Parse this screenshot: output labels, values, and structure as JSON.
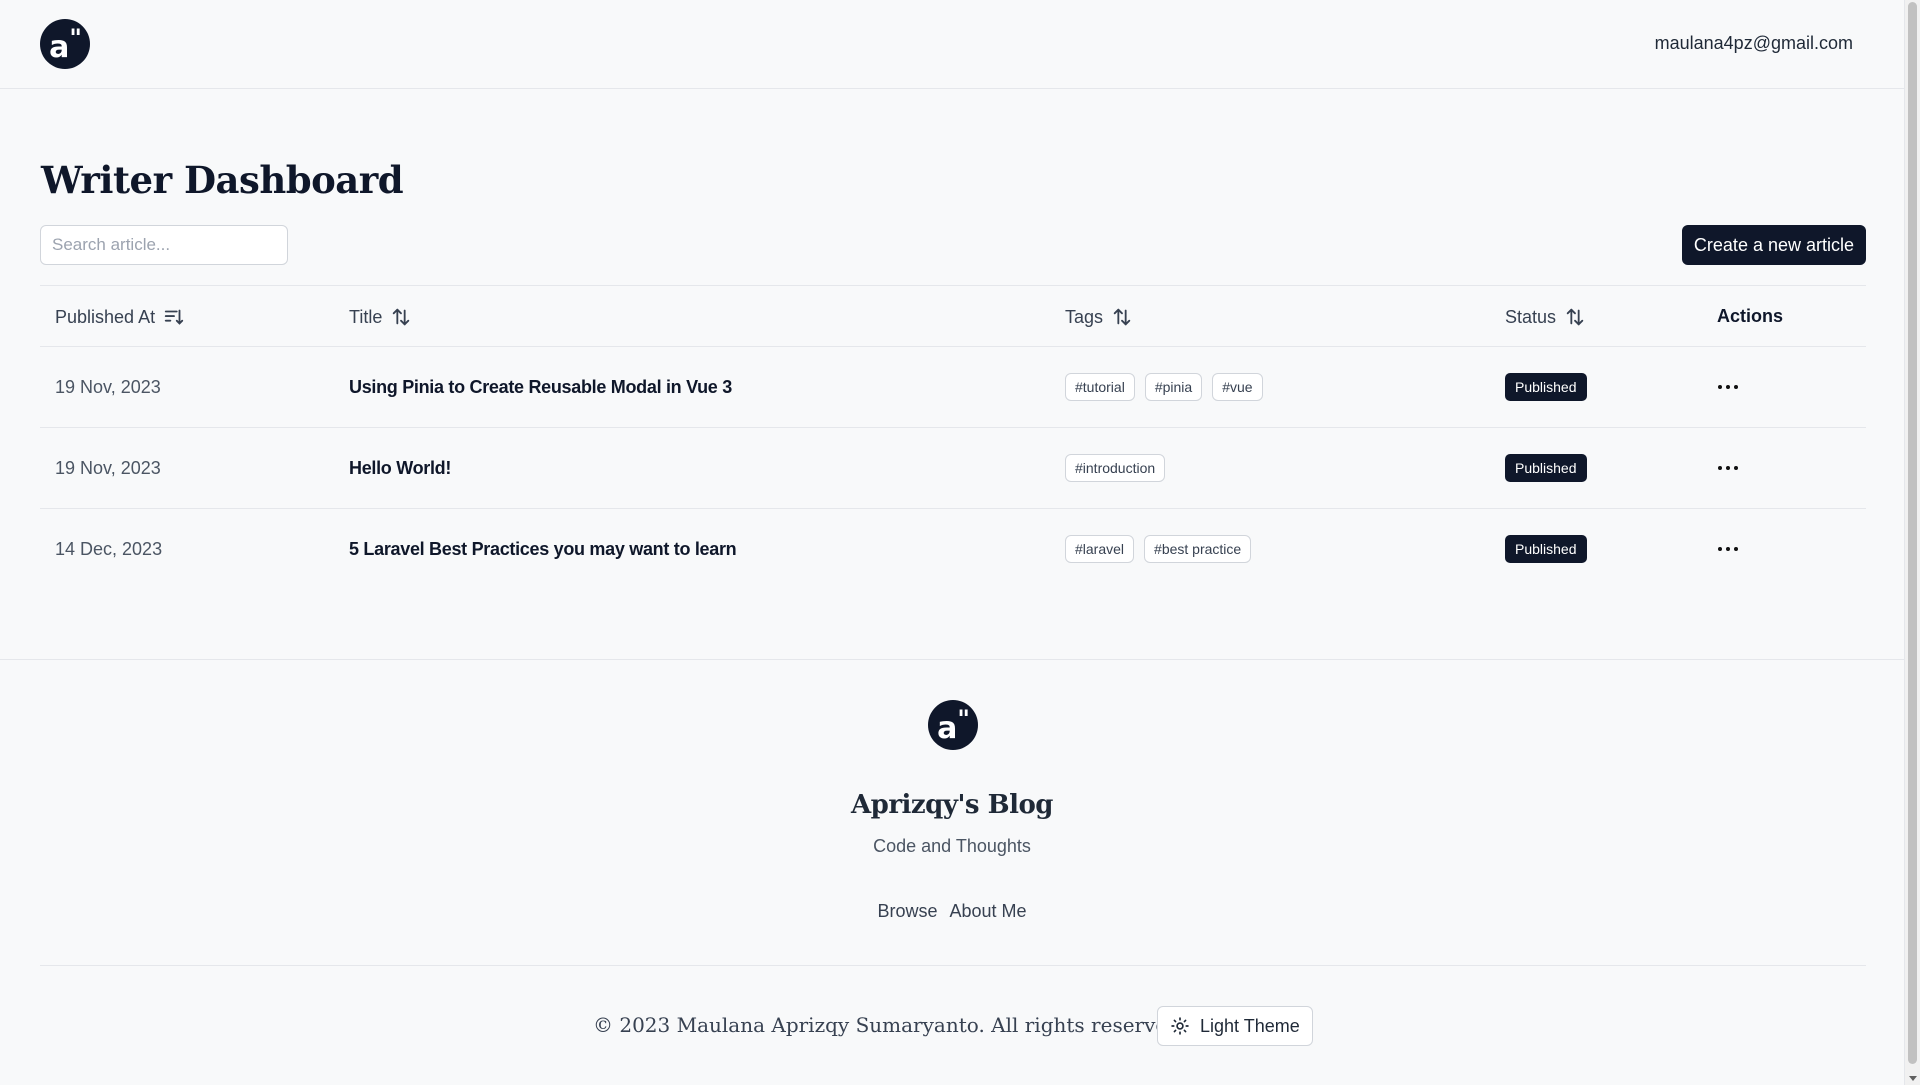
{
  "header": {
    "logo_text": "a\"",
    "user_email": "maulana4pz@gmail.com"
  },
  "main": {
    "title": "Writer Dashboard",
    "search_placeholder": "Search article...",
    "create_button": "Create a new article",
    "table": {
      "columns": {
        "published_at": "Published At",
        "title": "Title",
        "tags": "Tags",
        "status": "Status",
        "actions": "Actions"
      },
      "rows": [
        {
          "date": "19 Nov, 2023",
          "title": "Using Pinia to Create Reusable Modal in Vue 3",
          "tags": [
            "#tutorial",
            "#pinia",
            "#vue"
          ],
          "status": "Published"
        },
        {
          "date": "19 Nov, 2023",
          "title": "Hello World!",
          "tags": [
            "#introduction"
          ],
          "status": "Published"
        },
        {
          "date": "14 Dec, 2023",
          "title": "5 Laravel Best Practices you may want to learn",
          "tags": [
            "#laravel",
            "#best practice"
          ],
          "status": "Published"
        }
      ]
    }
  },
  "footer": {
    "blog_name": "Aprizqy's Blog",
    "tagline": "Code and Thoughts",
    "nav": [
      "Browse",
      "About Me"
    ],
    "copyright": "© 2023 Maulana Aprizqy Sumaryanto. All rights reserved.",
    "theme_button": "Light Theme"
  }
}
